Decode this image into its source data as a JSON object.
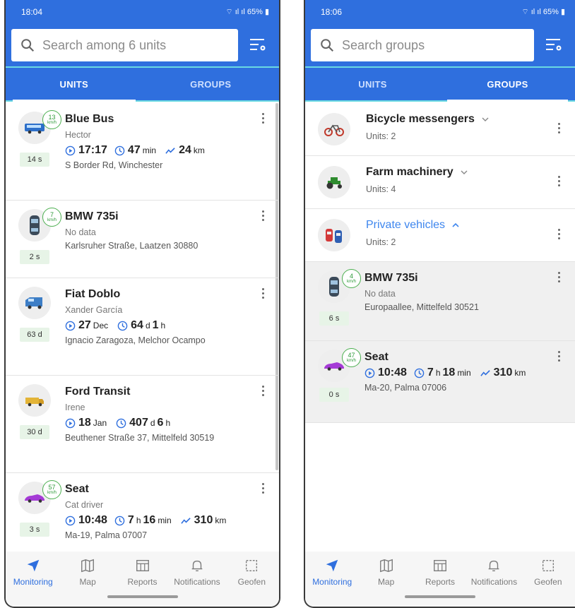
{
  "left": {
    "status_time": "18:04",
    "status_system": "65%",
    "search_placeholder": "Search among 6 units",
    "tabs": [
      "UNITS",
      "GROUPS"
    ],
    "active_tab": "UNITS",
    "units": [
      {
        "name": "Blue Bus",
        "speed": "13",
        "speed_unit": "km/h",
        "driver": "Hector",
        "age": "14 s",
        "time": "17:17",
        "duration_main": "47",
        "duration_unit": "min",
        "distance": "24",
        "distance_unit": "km",
        "address": "S Border Rd, Winchester",
        "icon": "bus-icon"
      },
      {
        "name": "BMW 735i",
        "speed": "7",
        "speed_unit": "km/h",
        "driver": "No data",
        "age": "2 s",
        "address": "Karlsruher Straße, Laatzen 30880",
        "icon": "car-icon"
      },
      {
        "name": "Fiat Doblo",
        "driver": "Xander García",
        "age": "63 d",
        "date_main": "27",
        "date_unit": "Dec",
        "duration_a": "64",
        "duration_a_unit": "d",
        "duration_b": "1",
        "duration_b_unit": "h",
        "address": "Ignacio Zaragoza, Melchor Ocampo",
        "icon": "van-icon"
      },
      {
        "name": "Ford Transit",
        "driver": "Irene",
        "age": "30 d",
        "date_main": "18",
        "date_unit": "Jan",
        "duration_a": "407",
        "duration_a_unit": "d",
        "duration_b": "6",
        "duration_b_unit": "h",
        "address": "Beuthener Straße 37, Mittelfeld 30519",
        "icon": "truck-icon"
      },
      {
        "name": "Seat",
        "speed": "57",
        "speed_unit": "km/h",
        "driver": "Cat driver",
        "age": "3 s",
        "time": "10:48",
        "duration_a": "7",
        "duration_a_unit": "h",
        "duration_b": "16",
        "duration_b_unit": "min",
        "distance": "310",
        "distance_unit": "km",
        "address": "Ma-19, Palma 07007",
        "icon": "sportscar-icon"
      }
    ]
  },
  "right": {
    "status_time": "18:06",
    "status_system": "65%",
    "search_placeholder": "Search groups",
    "tabs": [
      "UNITS",
      "GROUPS"
    ],
    "active_tab": "GROUPS",
    "groups": [
      {
        "name": "Bicycle messengers",
        "count": "Units: 2",
        "icon": "bicycle-icon"
      },
      {
        "name": "Farm machinery",
        "count": "Units: 4",
        "icon": "tractor-icon"
      },
      {
        "name": "Private vehicles",
        "count": "Units: 2",
        "icon": "cars-icon",
        "expanded": true
      }
    ],
    "units": [
      {
        "name": "BMW 735i",
        "speed": "4",
        "speed_unit": "km/h",
        "driver": "No data",
        "age": "6 s",
        "address": "Europaallee, Mittelfeld 30521"
      },
      {
        "name": "Seat",
        "speed": "47",
        "speed_unit": "km/h",
        "age": "0 s",
        "time": "10:48",
        "duration_a": "7",
        "duration_a_unit": "h",
        "duration_b": "18",
        "duration_b_unit": "min",
        "distance": "310",
        "distance_unit": "km",
        "address": "Ma-20, Palma 07006"
      }
    ]
  },
  "nav": [
    "Monitoring",
    "Map",
    "Reports",
    "Notifications",
    "Geofen"
  ],
  "colors": {
    "primary": "#2f6fde",
    "speed_ring": "#4caf50",
    "age_bg": "#e7f4e7",
    "group_expanded": "#3e86ee",
    "tab_highlight": "#6ad9e2"
  }
}
